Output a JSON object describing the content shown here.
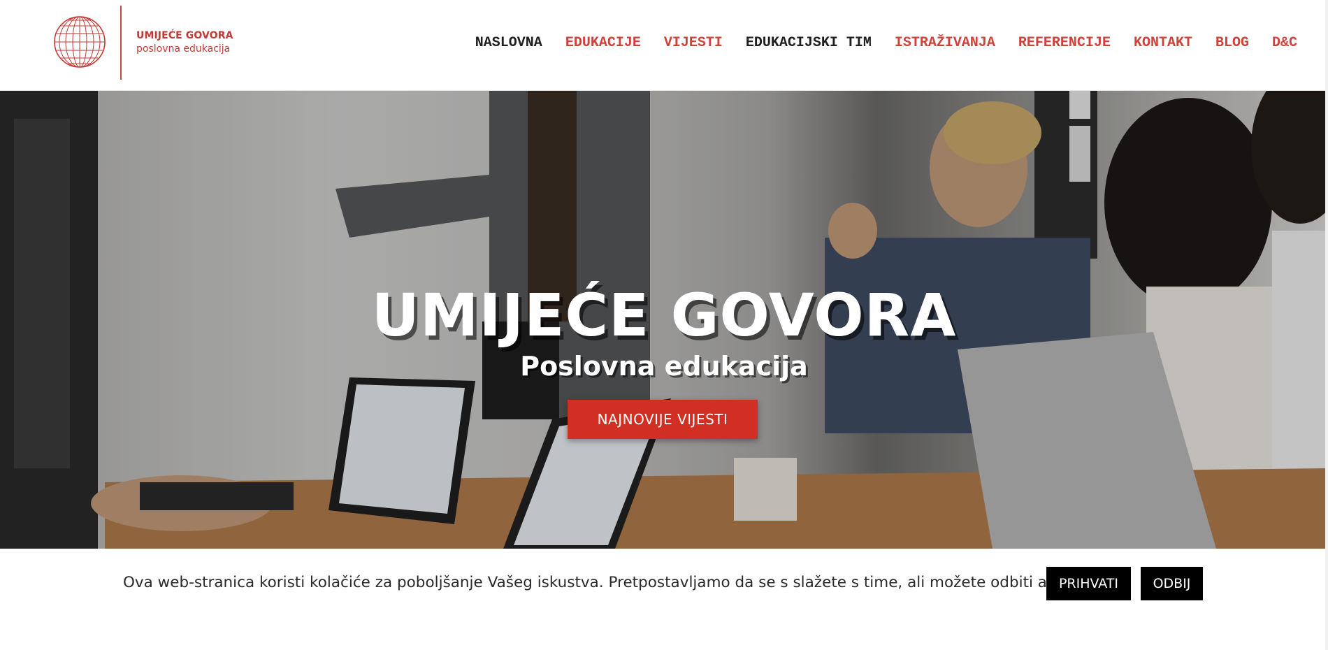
{
  "header": {
    "logo": {
      "title": "UMIJEĆE GOVORA",
      "subtitle": "poslovna edukacija",
      "icon": "globe-icon",
      "color": "#c23a35"
    },
    "nav": [
      {
        "label": "NASLOVNA",
        "color": "#1e1e1e"
      },
      {
        "label": "EDUKACIJE",
        "color": "#d0413a"
      },
      {
        "label": "VIJESTI",
        "color": "#d0413a"
      },
      {
        "label": "EDUKACIJSKI TIM",
        "color": "#1e1e1e"
      },
      {
        "label": "ISTRAŽIVANJA",
        "color": "#d0413a"
      },
      {
        "label": "REFERENCIJE",
        "color": "#d0413a"
      },
      {
        "label": "KONTAKT",
        "color": "#d0413a"
      },
      {
        "label": "BLOG",
        "color": "#d0413a"
      },
      {
        "label": "D&C",
        "color": "#d0413a"
      }
    ]
  },
  "hero": {
    "title": "UMIJEĆE GOVORA",
    "subtitle": "Poslovna edukacija",
    "cta_label": "NAJNOVIJE VIJESTI",
    "cta_color": "#d22f24"
  },
  "cookie": {
    "text": "Ova web-stranica koristi kolačiće za poboljšanje Vašeg iskustva. Pretpostavljamo da se s slažete s time, ali možete odbiti ako želite.",
    "accept_label": "PRIHVATI",
    "reject_label": "ODBIJ"
  }
}
